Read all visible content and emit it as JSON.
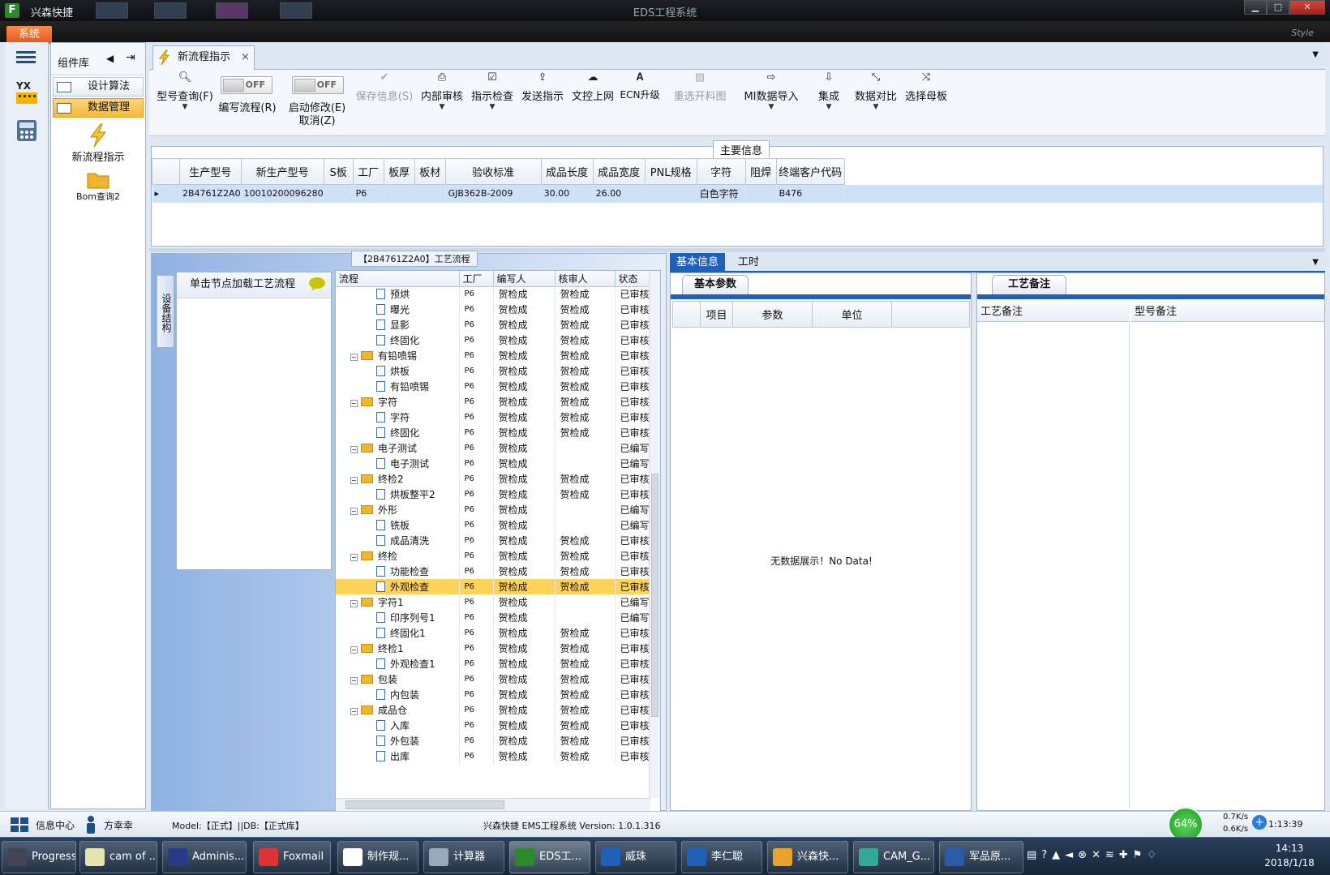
{
  "window": {
    "app_title": "兴森快捷",
    "title": "EDS工程系统",
    "style_label": "Style",
    "menu_label": "系统"
  },
  "component_panel": {
    "title": "组件库",
    "items": [
      {
        "label": "设计算法"
      },
      {
        "label": "数据管理"
      }
    ],
    "tools": [
      {
        "label": "新流程指示"
      },
      {
        "label": "Bom查询2"
      }
    ]
  },
  "tab": {
    "label": "新流程指示"
  },
  "toolbar": {
    "model_query": "型号查询(F)",
    "edit_flow": "编写流程(R)",
    "start_edit": "启动修改(E)",
    "cancel": "取消(Z)",
    "toggle_off": "OFF",
    "save_info": "保存信息(S)",
    "internal_review": "内部审核",
    "instruction_check": "指示检查",
    "send_instruction": "发送指示",
    "upload_docs": "文控上网",
    "ecn_upgrade": "ECN升级",
    "reselect_drawing": "重选开料图",
    "mi_import": "MI数据导入",
    "integrate": "集成",
    "compare": "数据对比",
    "select_master": "选择母板"
  },
  "main_info": {
    "title": "主要信息",
    "columns": [
      "生产型号",
      "新生产型号",
      "S板",
      "工厂",
      "板厚",
      "板材",
      "验收标准",
      "成品长度",
      "成品宽度",
      "PNL规格",
      "字符",
      "阻焊",
      "终端客户代码"
    ],
    "row": [
      "2B4761Z2A0",
      "10010200096280",
      "",
      "P6",
      "",
      "",
      "GJB362B-2009",
      "30.00",
      "26.00",
      "",
      "白色字符",
      "",
      "B476"
    ]
  },
  "flow": {
    "title": "【2B4761Z2A0】工艺流程",
    "side_tab": "设备结构",
    "load_hint": "单击节点加载工艺流程",
    "columns": [
      "流程",
      "工厂",
      "编写人",
      "核审人",
      "状态"
    ],
    "rows": [
      {
        "name": "预烘",
        "level": 2,
        "factory": "P6",
        "writer": "贺检成",
        "reviewer": "贺检成",
        "status": "已审核"
      },
      {
        "name": "曝光",
        "level": 2,
        "factory": "P6",
        "writer": "贺检成",
        "reviewer": "贺检成",
        "status": "已审核"
      },
      {
        "name": "显影",
        "level": 2,
        "factory": "P6",
        "writer": "贺检成",
        "reviewer": "贺检成",
        "status": "已审核"
      },
      {
        "name": "终固化",
        "level": 2,
        "factory": "P6",
        "writer": "贺检成",
        "reviewer": "贺检成",
        "status": "已审核"
      },
      {
        "name": "有铅喷锡",
        "level": 1,
        "factory": "P6",
        "writer": "贺检成",
        "reviewer": "贺检成",
        "status": "已审核"
      },
      {
        "name": "烘板",
        "level": 2,
        "factory": "P6",
        "writer": "贺检成",
        "reviewer": "贺检成",
        "status": "已审核"
      },
      {
        "name": "有铅喷锡",
        "level": 2,
        "factory": "P6",
        "writer": "贺检成",
        "reviewer": "贺检成",
        "status": "已审核"
      },
      {
        "name": "字符",
        "level": 1,
        "factory": "P6",
        "writer": "贺检成",
        "reviewer": "贺检成",
        "status": "已审核"
      },
      {
        "name": "字符",
        "level": 2,
        "factory": "P6",
        "writer": "贺检成",
        "reviewer": "贺检成",
        "status": "已审核"
      },
      {
        "name": "终固化",
        "level": 2,
        "factory": "P6",
        "writer": "贺检成",
        "reviewer": "贺检成",
        "status": "已审核"
      },
      {
        "name": "电子测试",
        "level": 1,
        "factory": "P6",
        "writer": "贺检成",
        "reviewer": "",
        "status": "已编写"
      },
      {
        "name": "电子测试",
        "level": 2,
        "factory": "P6",
        "writer": "贺检成",
        "reviewer": "",
        "status": "已编写"
      },
      {
        "name": "终检2",
        "level": 1,
        "factory": "P6",
        "writer": "贺检成",
        "reviewer": "贺检成",
        "status": "已审核"
      },
      {
        "name": "烘板整平2",
        "level": 2,
        "factory": "P6",
        "writer": "贺检成",
        "reviewer": "贺检成",
        "status": "已审核"
      },
      {
        "name": "外形",
        "level": 1,
        "factory": "P6",
        "writer": "贺检成",
        "reviewer": "",
        "status": "已编写"
      },
      {
        "name": "铣板",
        "level": 2,
        "factory": "P6",
        "writer": "贺检成",
        "reviewer": "",
        "status": "已编写"
      },
      {
        "name": "成品清洗",
        "level": 2,
        "factory": "P6",
        "writer": "贺检成",
        "reviewer": "贺检成",
        "status": "已审核"
      },
      {
        "name": "终检",
        "level": 1,
        "factory": "P6",
        "writer": "贺检成",
        "reviewer": "贺检成",
        "status": "已审核"
      },
      {
        "name": "功能检查",
        "level": 2,
        "factory": "P6",
        "writer": "贺检成",
        "reviewer": "贺检成",
        "status": "已审核"
      },
      {
        "name": "外观检查",
        "level": 2,
        "factory": "P6",
        "writer": "贺检成",
        "reviewer": "贺检成",
        "status": "已审核",
        "selected": true
      },
      {
        "name": "字符1",
        "level": 1,
        "factory": "P6",
        "writer": "贺检成",
        "reviewer": "",
        "status": "已编写"
      },
      {
        "name": "印序列号1",
        "level": 2,
        "factory": "P6",
        "writer": "贺检成",
        "reviewer": "",
        "status": "已编写"
      },
      {
        "name": "终固化1",
        "level": 2,
        "factory": "P6",
        "writer": "贺检成",
        "reviewer": "贺检成",
        "status": "已审核"
      },
      {
        "name": "终检1",
        "level": 1,
        "factory": "P6",
        "writer": "贺检成",
        "reviewer": "贺检成",
        "status": "已审核"
      },
      {
        "name": "外观检查1",
        "level": 2,
        "factory": "P6",
        "writer": "贺检成",
        "reviewer": "贺检成",
        "status": "已审核"
      },
      {
        "name": "包装",
        "level": 1,
        "factory": "P6",
        "writer": "贺检成",
        "reviewer": "贺检成",
        "status": "已审核"
      },
      {
        "name": "内包装",
        "level": 2,
        "factory": "P6",
        "writer": "贺检成",
        "reviewer": "贺检成",
        "status": "已审核"
      },
      {
        "name": "成品仓",
        "level": 1,
        "factory": "P6",
        "writer": "贺检成",
        "reviewer": "贺检成",
        "status": "已审核"
      },
      {
        "name": "入库",
        "level": 2,
        "factory": "P6",
        "writer": "贺检成",
        "reviewer": "贺检成",
        "status": "已审核"
      },
      {
        "name": "外包装",
        "level": 2,
        "factory": "P6",
        "writer": "贺检成",
        "reviewer": "贺检成",
        "status": "已审核"
      },
      {
        "name": "出库",
        "level": 2,
        "factory": "P6",
        "writer": "贺检成",
        "reviewer": "贺检成",
        "status": "已审核"
      }
    ]
  },
  "right": {
    "tabs": [
      "基本信息",
      "工时"
    ],
    "basic_params": {
      "title": "基本参数",
      "columns": [
        "项目",
        "参数",
        "单位"
      ],
      "empty": "无数据展示！No Data!"
    },
    "remarks": {
      "title": "工艺备注",
      "columns": [
        "工艺备注",
        "型号备注"
      ]
    }
  },
  "status": {
    "info_center": "信息中心",
    "user": "方幸幸",
    "model": "Model:【正式】||DB:【正式库】",
    "version": "兴森快捷 EMS工程系统 Version: 1.0.1.316",
    "net_percent": "64%",
    "up_speed": "0.7K/s",
    "down_speed": "0.6K/s",
    "clock": "1:13:39"
  },
  "taskbar": {
    "items": [
      "Progress",
      "cam of ...",
      "Adminis...",
      "Foxmail",
      "制作规...",
      "计算器",
      "EDS工...",
      "威珠",
      "李仁聪",
      "兴森快...",
      "CAM_G...",
      "军品原..."
    ],
    "time": "14:13",
    "date": "2018/1/18"
  }
}
